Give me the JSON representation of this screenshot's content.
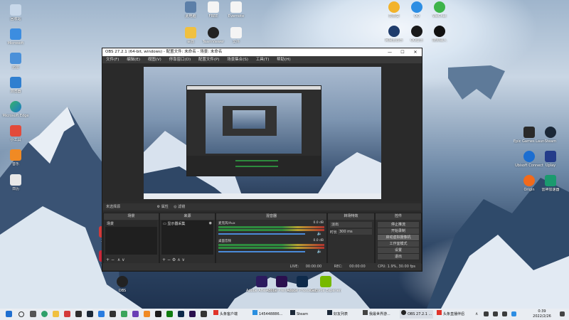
{
  "desktop_icons_left": [
    "回收站",
    "Microsoft",
    "迅雷",
    "浏览器",
    "Microsoft Edge",
    "小工具",
    "音乐",
    "日历",
    "工具",
    "百度",
    "IM"
  ],
  "desktop_icons_top": [
    "此电脑",
    "FREE",
    "Evernote",
    "桌面",
    "TeamViewer",
    "文件"
  ],
  "desktop_icons_topright": [
    "向日葵",
    "QQ",
    "WeChat",
    "网易云音乐",
    "QQ音乐",
    "搜狗输入"
  ],
  "desktop_icons_right": [
    "Epic Games Launcher",
    "Steam",
    "Ubisoft Connect",
    "Uplay",
    "Origin",
    "雷神加速器"
  ],
  "desktop_icons_bottom": [
    "OBS",
    "Adobe After Effects 2020",
    "Adobe Premiere Pro",
    "Adobe Photoshop",
    "GeForce Experience"
  ],
  "obs": {
    "title": "OBS 27.2.1 (64-bit, windows) - 配置文件: 未命名 - 场景: 未命名",
    "window_controls": [
      "—",
      "☐",
      "✕"
    ],
    "menu": [
      "文件(F)",
      "编辑(E)",
      "视图(V)",
      "停靠窗口(D)",
      "配置文件(P)",
      "场景集合(S)",
      "工具(T)",
      "帮助(H)"
    ],
    "scene_bar": {
      "scene_label": "未选择源",
      "settings_label": "属性",
      "filters_label": "滤镜"
    },
    "docks": {
      "scenes": {
        "title": "场景",
        "items": [
          "场景"
        ]
      },
      "sources": {
        "title": "来源",
        "items": [
          "显示器采集"
        ]
      },
      "mixer": {
        "title": "混音器",
        "channels": [
          {
            "name": "麦克风/Aux",
            "db": "0.0 dB"
          },
          {
            "name": "桌面音频",
            "db": "0.0 dB"
          }
        ]
      },
      "transitions": {
        "title": "转场特效",
        "type": "淡出",
        "duration_label": "时长",
        "duration": "300 ms"
      },
      "controls": {
        "title": "控件",
        "buttons": [
          "停止推流",
          "开始录制",
          "启动虚拟摄像机",
          "工作室模式",
          "设置",
          "退出"
        ]
      }
    },
    "status": {
      "live_label": "LIVE:",
      "live_time": "00:00:00",
      "rec_label": "REC:",
      "rec_time": "00:00:00",
      "cpu": "CPU: 1.9%, 30.00 fps"
    }
  },
  "taskbar": {
    "items": [
      "头条客户端",
      "145448886...",
      "Steam",
      "好友列表",
      "我最世界游...",
      "OBS 27.2.1 ...",
      "头条直播伴侣"
    ],
    "tray": {
      "time": "0:39",
      "date": "2022/2/26"
    },
    "icons": [
      "windows-icon",
      "search-icon",
      "taskview-icon",
      "edge-icon"
    ]
  },
  "colors": {
    "obs_bg": "#2b2b2b",
    "taskbar": "#e9edf2",
    "accent_green": "#2e8b3e"
  }
}
